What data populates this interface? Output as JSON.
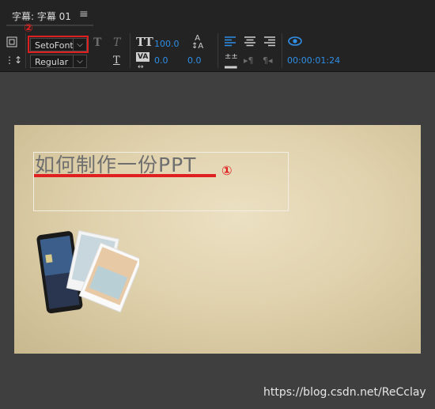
{
  "panel": {
    "title": "字幕: 字幕 01",
    "menu_icon": "hamburger-icon"
  },
  "toolbar": {
    "font_family": "SetoFont",
    "font_style": "Regular",
    "font_size": "100.0",
    "kerning": "0.0",
    "leading": "0.0",
    "timecode": "00:00:01:24"
  },
  "annotations": {
    "marker_1": "①",
    "marker_2": "②",
    "marker_color": "#e02020"
  },
  "preview": {
    "caption_text": "如何制作一份PPT"
  },
  "watermark": "https://blog.csdn.net/ReCclay"
}
